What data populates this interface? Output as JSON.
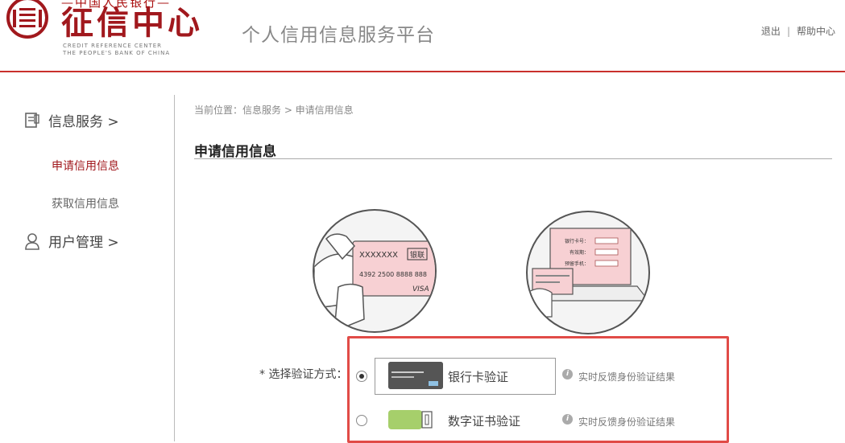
{
  "header": {
    "logo_top": "—中国人民银行—",
    "logo_title": "征信中心",
    "logo_en_line1": "CREDIT REFERENCE CENTER",
    "logo_en_line2": "THE PEOPLE'S BANK OF CHINA",
    "platform_title": "个人信用信息服务平台",
    "links": {
      "logout": "退出",
      "separator": "|",
      "help": "帮助中心"
    }
  },
  "sidebar": {
    "groups": [
      {
        "label": "信息服务 >",
        "icon": "document-icon"
      },
      {
        "label": "用户管理 >",
        "icon": "user-icon"
      }
    ],
    "items": [
      {
        "label": "申请信用信息",
        "active": true
      },
      {
        "label": "获取信用信息",
        "active": false
      }
    ]
  },
  "main": {
    "breadcrumb": "当前位置：信息服务 > 申请信用信息",
    "title": "申请信用信息",
    "illustration1": {
      "card_name": "XXXXXXX",
      "card_brand": "银联",
      "card_number": "4392 2500 8888 888",
      "card_network": "VISA"
    },
    "illustration2": {
      "field1": "银行卡号：",
      "field2": "有效期：",
      "field3": "预留手机："
    },
    "method_label": "* 选择验证方式：",
    "options": [
      {
        "label": "银行卡验证",
        "hint": "实时反馈身份验证结果",
        "selected": true,
        "icon": "bank-card-icon"
      },
      {
        "label": "数字证书验证",
        "hint": "实时反馈身份验证结果",
        "selected": false,
        "icon": "digital-certificate-icon"
      }
    ]
  },
  "colors": {
    "brand_red": "#a1181d",
    "header_line": "#c9302c",
    "highlight": "#e14b47"
  }
}
